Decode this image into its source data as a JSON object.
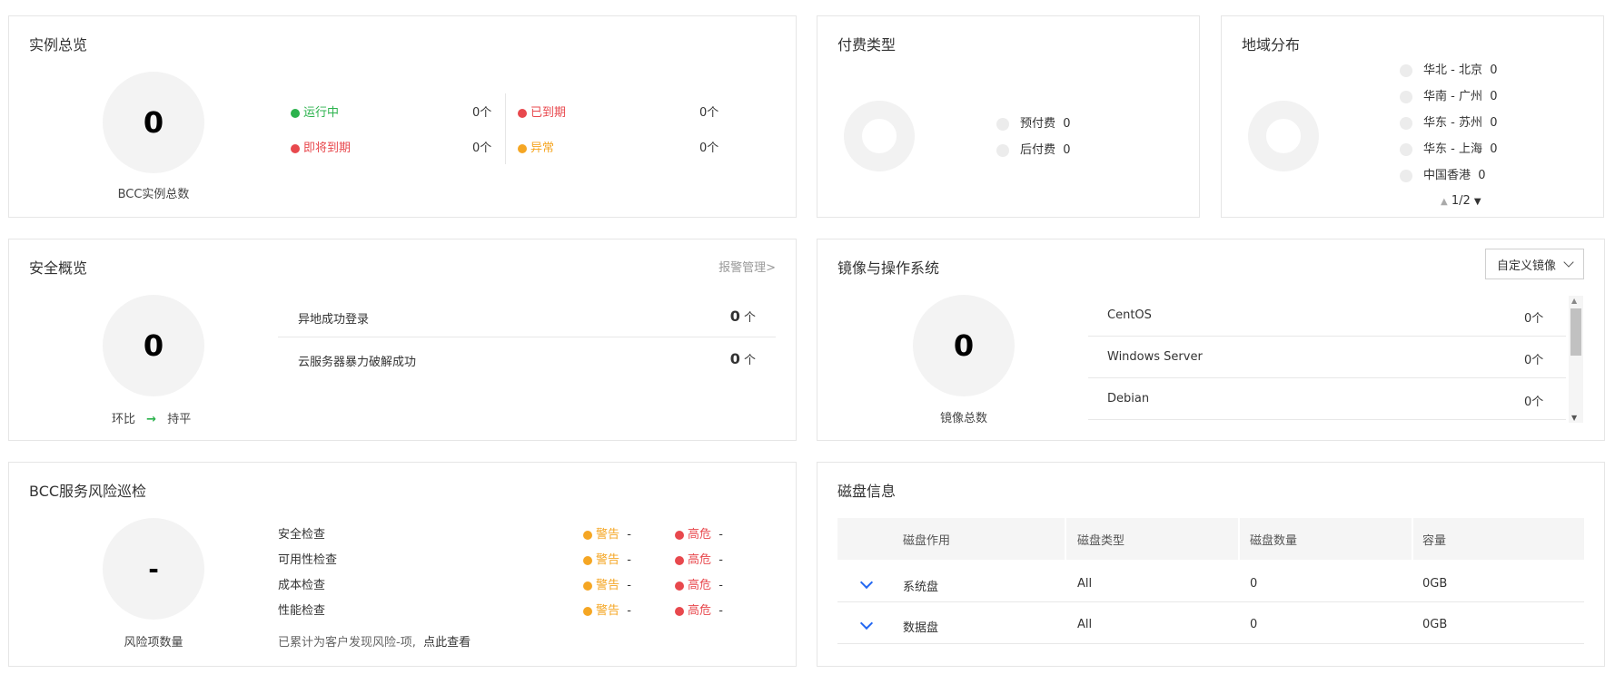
{
  "instances": {
    "title": "实例总览",
    "total": "0",
    "total_label": "BCC实例总数",
    "statuses": [
      {
        "label": "运行中",
        "count": "0个",
        "color": "#2bb24c"
      },
      {
        "label": "已到期",
        "count": "0个",
        "color": "#e8484d"
      },
      {
        "label": "即将到期",
        "count": "0个",
        "color": "#e8484d"
      },
      {
        "label": "异常",
        "count": "0个",
        "color": "#f5a623"
      }
    ]
  },
  "payment": {
    "title": "付费类型",
    "legend": [
      {
        "label": "预付费",
        "value": "0"
      },
      {
        "label": "后付费",
        "value": "0"
      }
    ]
  },
  "region": {
    "title": "地域分布",
    "legend": [
      {
        "label": "华北 - 北京",
        "value": "0"
      },
      {
        "label": "华南 - 广州",
        "value": "0"
      },
      {
        "label": "华东 - 苏州",
        "value": "0"
      },
      {
        "label": "华东 - 上海",
        "value": "0"
      },
      {
        "label": "中国香港",
        "value": "0"
      }
    ],
    "pager": "1/2"
  },
  "security": {
    "title": "安全概览",
    "link": "报警管理>",
    "total": "0",
    "trend_label": "环比",
    "trend_value": "持平",
    "trend_color": "#2bb24c",
    "items": [
      {
        "label": "异地成功登录",
        "count": "0",
        "unit": "个"
      },
      {
        "label": "云服务器暴力破解成功",
        "count": "0",
        "unit": "个"
      }
    ]
  },
  "images": {
    "title": "镜像与操作系统",
    "select_value": "自定义镜像",
    "total": "0",
    "total_label": "镜像总数",
    "rows": [
      {
        "name": "CentOS",
        "count": "0个"
      },
      {
        "name": "Windows Server",
        "count": "0个"
      },
      {
        "name": "Debian",
        "count": "0个"
      }
    ]
  },
  "risk": {
    "title": "BCC服务风险巡检",
    "total": "-",
    "total_label": "风险项数量",
    "warn_label": "警告",
    "high_label": "高危",
    "warn_color": "#f5a623",
    "high_color": "#e8484d",
    "checks": [
      {
        "label": "安全检查",
        "warn": "-",
        "high": "-"
      },
      {
        "label": "可用性检查",
        "warn": "-",
        "high": "-"
      },
      {
        "label": "成本检查",
        "warn": "-",
        "high": "-"
      },
      {
        "label": "性能检查",
        "warn": "-",
        "high": "-"
      }
    ],
    "summary": "已累计为客户发现风险-项,",
    "view_link": "点此查看"
  },
  "disk": {
    "title": "磁盘信息",
    "headers": [
      "磁盘作用",
      "磁盘类型",
      "磁盘数量",
      "容量"
    ],
    "rows": [
      {
        "role": "系统盘",
        "type": "All",
        "count": "0",
        "capacity": "0GB"
      },
      {
        "role": "数据盘",
        "type": "All",
        "count": "0",
        "capacity": "0GB"
      }
    ]
  }
}
